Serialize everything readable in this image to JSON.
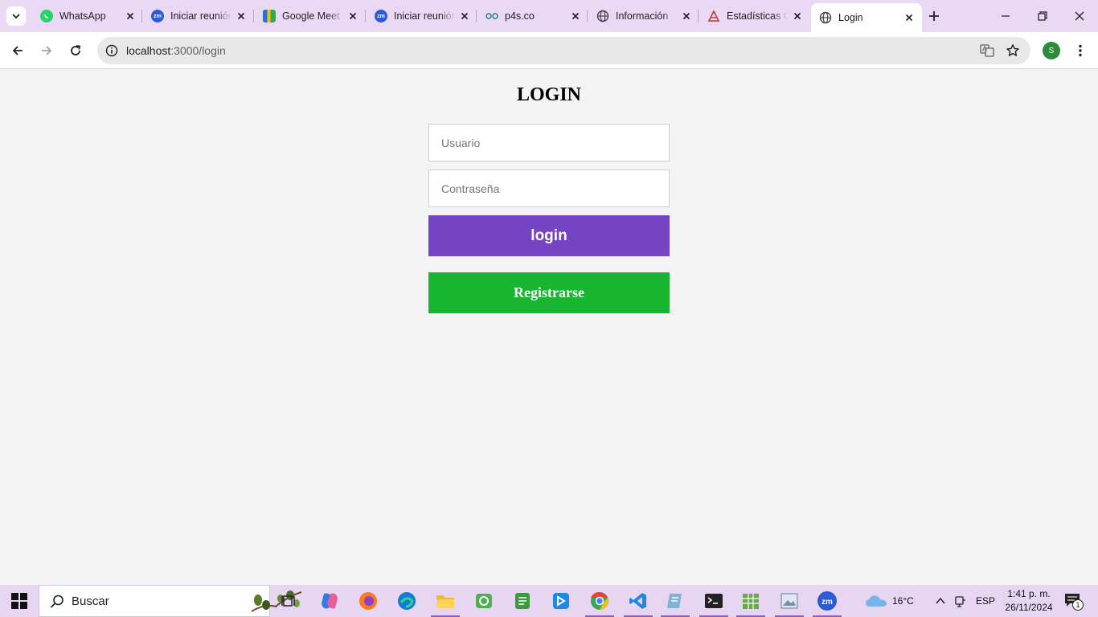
{
  "browser": {
    "tabs": [
      {
        "title": "WhatsApp",
        "icon": "whatsapp-icon"
      },
      {
        "title": "Iniciar reunión",
        "icon": "zoom-icon"
      },
      {
        "title": "Google Meet",
        "icon": "google-meet-icon"
      },
      {
        "title": "Iniciar reunión",
        "icon": "zoom-icon"
      },
      {
        "title": "p4s.co",
        "icon": "p4s-icon"
      },
      {
        "title": "Información",
        "icon": "globe-icon"
      },
      {
        "title": "Estadísticas C",
        "icon": "stats-icon"
      },
      {
        "title": "Login",
        "icon": "globe-icon"
      }
    ],
    "active_tab_index": 7,
    "url_host": "localhost",
    "url_path": ":3000/login",
    "profile_initial": "S"
  },
  "login": {
    "title": "LOGIN",
    "username_placeholder": "Usuario",
    "password_placeholder": "Contraseña",
    "login_button": "login",
    "register_button": "Registrarse"
  },
  "taskbar": {
    "search_placeholder": "Buscar",
    "weather": "16°C",
    "language": "ESP",
    "time": "1:41 p. m.",
    "date": "26/11/2024",
    "notification_count": "1"
  },
  "colors": {
    "login_button": "#7444c4",
    "register_button": "#17b530",
    "tabstrip": "#e9d9f4",
    "page_bg": "#f4f4f4"
  }
}
